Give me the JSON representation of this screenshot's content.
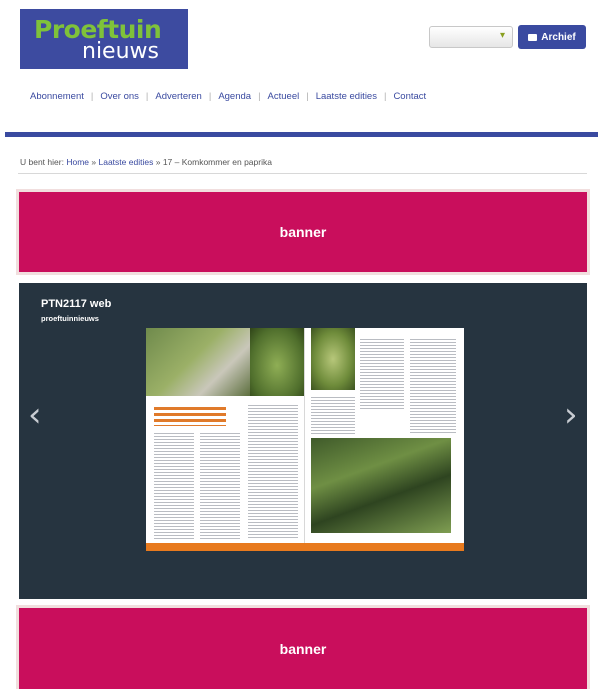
{
  "logo": {
    "line1": "Proeftuin",
    "line2": "nieuws"
  },
  "header": {
    "archive_button": "Archief",
    "select_value": ""
  },
  "nav": [
    "Abonnement",
    "Over ons",
    "Adverteren",
    "Agenda",
    "Actueel",
    "Laatste edities",
    "Contact"
  ],
  "breadcrumb": {
    "prefix": "U bent hier:",
    "home": "Home",
    "sep1": "»",
    "editions": "Laatste edities",
    "sep2": "»",
    "current": "17 – Komkommer en paprika"
  },
  "banners": {
    "top": "banner",
    "bottom": "banner"
  },
  "viewer": {
    "title": "PTN2117 web",
    "subtitle": "proeftuinnieuws"
  },
  "icons": {
    "archive": "archive-box-icon",
    "prev": "chevron-left-icon",
    "next": "chevron-right-icon",
    "dropdown": "chevron-down-icon"
  },
  "colors": {
    "brand_blue": "#3a4aa0",
    "logo_green": "#7fc23a",
    "banner_magenta": "#c90e5c",
    "viewer_bg": "#263440",
    "magazine_accent": "#e87a1e"
  }
}
